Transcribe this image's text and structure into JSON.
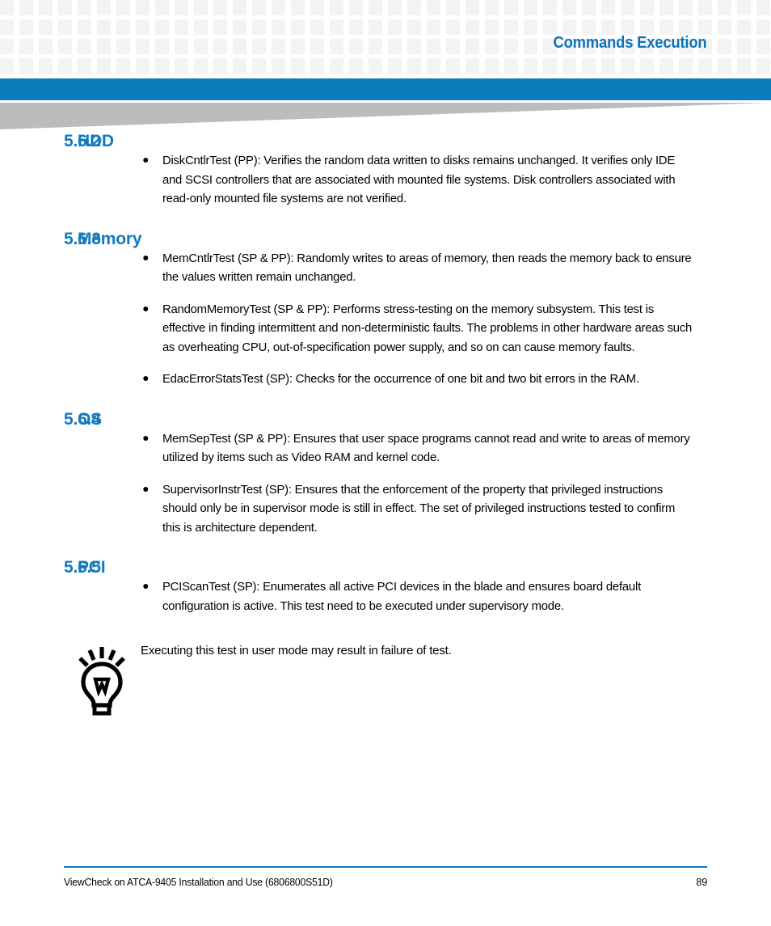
{
  "header": {
    "title": "Commands Execution",
    "accent_blue": "#0b7dbd",
    "grid_square_color": "#f3f3f3",
    "wedge_color": "#bcbcbc"
  },
  "sections": [
    {
      "number": "5.6.2",
      "title": "HDD",
      "bullets": [
        "DiskCntlrTest (PP): Verifies the random data written to disks remains unchanged. It verifies only IDE and SCSI controllers that are associated with mounted file systems.   Disk controllers associated with read-only mounted file systems are not verified."
      ]
    },
    {
      "number": "5.6.3",
      "title": "Memory",
      "bullets": [
        "MemCntlrTest (SP & PP): Randomly writes to areas of memory, then reads the memory back to ensure the values written remain unchanged.",
        "RandomMemoryTest (SP & PP): Performs stress-testing on the memory subsystem. This test is effective in finding intermittent and non-deterministic faults. The problems in other hardware areas such as overheating CPU, out-of-specification power supply, and so on can cause memory faults.",
        "EdacErrorStatsTest (SP): Checks for the occurrence of one bit and two bit errors in the RAM."
      ]
    },
    {
      "number": "5.6.4",
      "title": "OS",
      "bullets": [
        "MemSepTest (SP & PP): Ensures that user space programs cannot read and write to areas of memory utilized by items such as Video RAM and kernel code.",
        "SupervisorInstrTest (SP): Ensures that the enforcement of the property that privileged instructions should only be in supervisor mode is still in effect. The set of privileged instructions tested to confirm this is architecture dependent."
      ]
    },
    {
      "number": "5.6.5",
      "title": "PCI",
      "bullets": [
        "PCIScanTest (SP): Enumerates all active PCI devices in the blade and ensures board default configuration is active. This test need to be executed under supervisory mode."
      ]
    }
  ],
  "note": {
    "icon": "lightbulb-tip-icon",
    "text": "Executing this test in user mode may result in failure of test."
  },
  "footer": {
    "document": "ViewCheck on ATCA-9405 Installation and Use (6806800S51D)",
    "page_number": "89",
    "rule_color": "#1479bd"
  }
}
